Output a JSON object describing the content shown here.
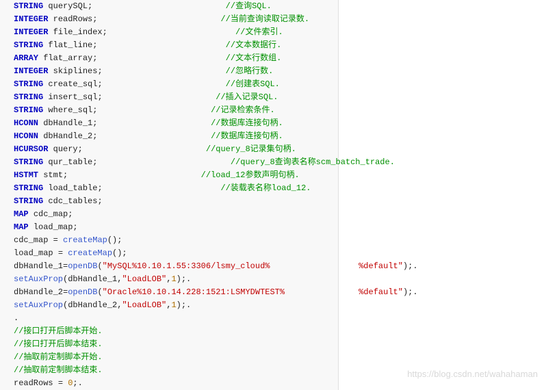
{
  "watermark": "https://blog.csdn.net/wahahaman",
  "lines": [
    [
      [
        "kw",
        "STRING"
      ],
      [
        "sp",
        " "
      ],
      [
        "id",
        "querySQL"
      ],
      [
        "sym",
        ";"
      ],
      [
        "pad",
        "                           "
      ],
      [
        "cmt",
        "//查询SQL."
      ]
    ],
    [
      [
        "kw",
        "INTEGER"
      ],
      [
        "sp",
        " "
      ],
      [
        "id",
        "readRows"
      ],
      [
        "sym",
        ";"
      ],
      [
        "pad",
        "                         "
      ],
      [
        "cmt",
        "//当前查询读取记录数."
      ]
    ],
    [
      [
        "kw",
        "INTEGER"
      ],
      [
        "sp",
        " "
      ],
      [
        "id",
        "file_index"
      ],
      [
        "sym",
        ";"
      ],
      [
        "pad",
        "                          "
      ],
      [
        "cmt",
        "//文件索引."
      ]
    ],
    [
      [
        "kw",
        "STRING"
      ],
      [
        "sp",
        " "
      ],
      [
        "id",
        "flat_line"
      ],
      [
        "sym",
        ";"
      ],
      [
        "pad",
        "                          "
      ],
      [
        "cmt",
        "//文本数据行."
      ]
    ],
    [
      [
        "kw",
        "ARRAY"
      ],
      [
        "sp",
        " "
      ],
      [
        "id",
        "flat_array"
      ],
      [
        "sym",
        ";"
      ],
      [
        "pad",
        "                          "
      ],
      [
        "cmt",
        "//文本行数组."
      ]
    ],
    [
      [
        "kw",
        "INTEGER"
      ],
      [
        "sp",
        " "
      ],
      [
        "id",
        "skiplines"
      ],
      [
        "sym",
        ";"
      ],
      [
        "pad",
        "                         "
      ],
      [
        "cmt",
        "//忽略行数."
      ]
    ],
    [
      [
        "kw",
        "STRING"
      ],
      [
        "sp",
        " "
      ],
      [
        "id",
        "create_sql"
      ],
      [
        "sym",
        ";"
      ],
      [
        "pad",
        "                         "
      ],
      [
        "cmt",
        "//创建表SQL."
      ]
    ],
    [
      [
        "kw",
        "STRING"
      ],
      [
        "sp",
        " "
      ],
      [
        "id",
        "insert_sql"
      ],
      [
        "sym",
        ";"
      ],
      [
        "pad",
        "                       "
      ],
      [
        "cmt",
        "//插入记录SQL."
      ]
    ],
    [
      [
        "kw",
        "STRING"
      ],
      [
        "sp",
        " "
      ],
      [
        "id",
        "where_sql"
      ],
      [
        "sym",
        ";"
      ],
      [
        "pad",
        "                       "
      ],
      [
        "cmt",
        "//记录检索条件."
      ]
    ],
    [
      [
        "kw",
        "HCONN"
      ],
      [
        "sp",
        " "
      ],
      [
        "id",
        "dbHandle_1"
      ],
      [
        "sym",
        ";"
      ],
      [
        "pad",
        "                       "
      ],
      [
        "cmt",
        "//数据库连接句柄."
      ]
    ],
    [
      [
        "kw",
        "HCONN"
      ],
      [
        "sp",
        " "
      ],
      [
        "id",
        "dbHandle_2"
      ],
      [
        "sym",
        ";"
      ],
      [
        "pad",
        "                       "
      ],
      [
        "cmt",
        "//数据库连接句柄."
      ]
    ],
    [
      [
        "kw",
        "HCURSOR"
      ],
      [
        "sp",
        " "
      ],
      [
        "id",
        "query"
      ],
      [
        "sym",
        ";"
      ],
      [
        "pad",
        "                         "
      ],
      [
        "cmt",
        "//query_8记录集句柄."
      ]
    ],
    [
      [
        "kw",
        "STRING"
      ],
      [
        "sp",
        " "
      ],
      [
        "id",
        "qur_table"
      ],
      [
        "sym",
        ";"
      ],
      [
        "pad",
        "                           "
      ],
      [
        "cmt",
        "//query_8查询表名称scm_batch_trade."
      ]
    ],
    [
      [
        "kw",
        "HSTMT"
      ],
      [
        "sp",
        " "
      ],
      [
        "id",
        "stmt"
      ],
      [
        "sym",
        ";"
      ],
      [
        "pad",
        "                           "
      ],
      [
        "cmt",
        "//load_12参数声明句柄."
      ]
    ],
    [
      [
        "kw",
        "STRING"
      ],
      [
        "sp",
        " "
      ],
      [
        "id",
        "load_table"
      ],
      [
        "sym",
        ";"
      ],
      [
        "pad",
        "                        "
      ],
      [
        "cmt",
        "//装载表名称load_12."
      ]
    ],
    [
      [
        "kw",
        "STRING"
      ],
      [
        "sp",
        " "
      ],
      [
        "id",
        "cdc_tables"
      ],
      [
        "sym",
        ";"
      ]
    ],
    [
      [
        "kw",
        "MAP"
      ],
      [
        "sp",
        " "
      ],
      [
        "id",
        "cdc_map"
      ],
      [
        "sym",
        ";"
      ]
    ],
    [
      [
        "kw",
        "MAP"
      ],
      [
        "sp",
        " "
      ],
      [
        "id",
        "load_map"
      ],
      [
        "sym",
        ";"
      ]
    ],
    [
      [
        "id",
        "cdc_map"
      ],
      [
        "sp",
        " "
      ],
      [
        "sym",
        "="
      ],
      [
        "sp",
        " "
      ],
      [
        "fn",
        "createMap"
      ],
      [
        "sym",
        "();"
      ]
    ],
    [
      [
        "id",
        "load_map"
      ],
      [
        "sp",
        " "
      ],
      [
        "sym",
        "="
      ],
      [
        "sp",
        " "
      ],
      [
        "fn",
        "createMap"
      ],
      [
        "sym",
        "();"
      ]
    ],
    [
      [
        "id",
        "dbHandle_1"
      ],
      [
        "sym",
        "="
      ],
      [
        "fn",
        "openDB"
      ],
      [
        "sym",
        "("
      ],
      [
        "str",
        "\"MySQL%10.10.1.55:3306/lsmy_cloud%"
      ],
      [
        "pad",
        "                  "
      ],
      [
        "str",
        "%default\""
      ],
      [
        "sym",
        ");."
      ]
    ],
    [
      [
        "fn",
        "setAuxProp"
      ],
      [
        "sym",
        "("
      ],
      [
        "id",
        "dbHandle_1"
      ],
      [
        "sym",
        ","
      ],
      [
        "str",
        "\"LoadLOB\""
      ],
      [
        "sym",
        ","
      ],
      [
        "num",
        "1"
      ],
      [
        "sym",
        ");."
      ]
    ],
    [
      [
        "id",
        "dbHandle_2"
      ],
      [
        "sym",
        "="
      ],
      [
        "fn",
        "openDB"
      ],
      [
        "sym",
        "("
      ],
      [
        "str",
        "\"Oracle%10.10.14.228:1521:LSMYDWTEST%"
      ],
      [
        "pad",
        "               "
      ],
      [
        "str",
        "%default\""
      ],
      [
        "sym",
        ");."
      ]
    ],
    [
      [
        "fn",
        "setAuxProp"
      ],
      [
        "sym",
        "("
      ],
      [
        "id",
        "dbHandle_2"
      ],
      [
        "sym",
        ","
      ],
      [
        "str",
        "\"LoadLOB\""
      ],
      [
        "sym",
        ","
      ],
      [
        "num",
        "1"
      ],
      [
        "sym",
        ");."
      ]
    ],
    [
      [
        "sym",
        "."
      ]
    ],
    [
      [
        "cmt",
        "//接口打开后脚本开始."
      ]
    ],
    [
      [
        "cmt",
        "//接口打开后脚本结束."
      ]
    ],
    [
      [
        "cmt",
        "//抽取前定制脚本开始."
      ]
    ],
    [
      [
        "cmt",
        "//抽取前定制脚本结束."
      ]
    ],
    [
      [
        "id",
        "readRows"
      ],
      [
        "sp",
        " "
      ],
      [
        "sym",
        "="
      ],
      [
        "sp",
        " "
      ],
      [
        "num",
        "0"
      ],
      [
        "sym",
        ";."
      ]
    ]
  ]
}
